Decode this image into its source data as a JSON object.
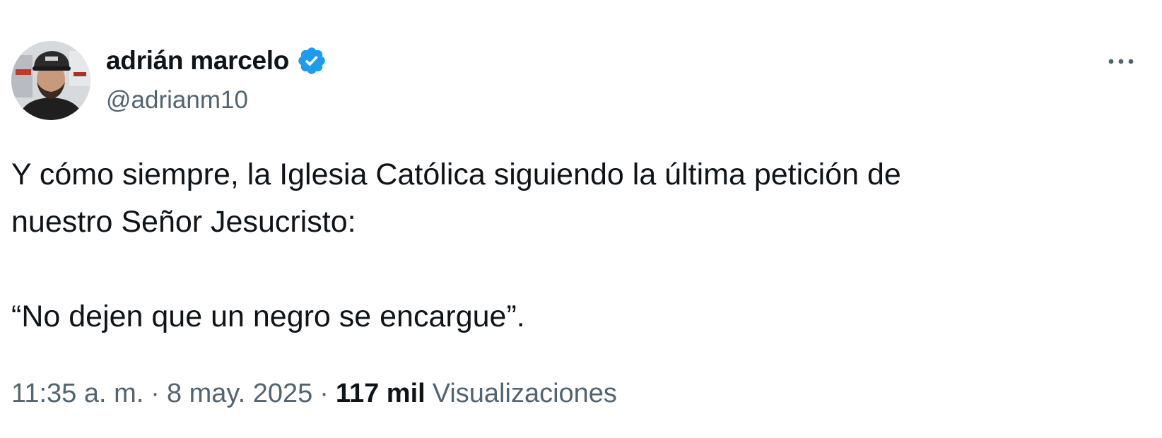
{
  "author": {
    "display_name": "adrián marcelo",
    "handle": "@adrianm10",
    "verified_icon": "verified-badge-icon",
    "verified_color": "#1d9bf0"
  },
  "menu": {
    "more_icon": "more-options-icon"
  },
  "tweet": {
    "paragraph_1": "Y cómo siempre, la Iglesia Católica siguiendo la última petición de nuestro Señor Jesucristo:",
    "paragraph_2": "“No dejen que un negro se encargue”."
  },
  "meta": {
    "time": "11:35 a. m.",
    "separator": "·",
    "date": "8 may. 2025",
    "views_count": "117 mil",
    "views_label": "Visualizaciones"
  },
  "colors": {
    "primary_text": "#0f1419",
    "secondary_text": "#536471",
    "accent": "#1d9bf0",
    "background": "#ffffff"
  }
}
